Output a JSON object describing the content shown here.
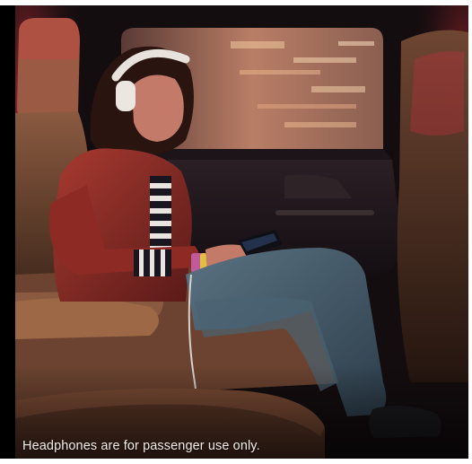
{
  "caption": {
    "text": "Headphones are for passenger use only."
  },
  "scene": {
    "subject": "passenger-with-headphones",
    "colors": {
      "window_glow": "#d8a07a",
      "interior_red": "#b0202a",
      "leather": "#6b4330",
      "jacket": "#8e2a24",
      "jeans": "#3f5566",
      "dark": "#120c0e"
    }
  }
}
